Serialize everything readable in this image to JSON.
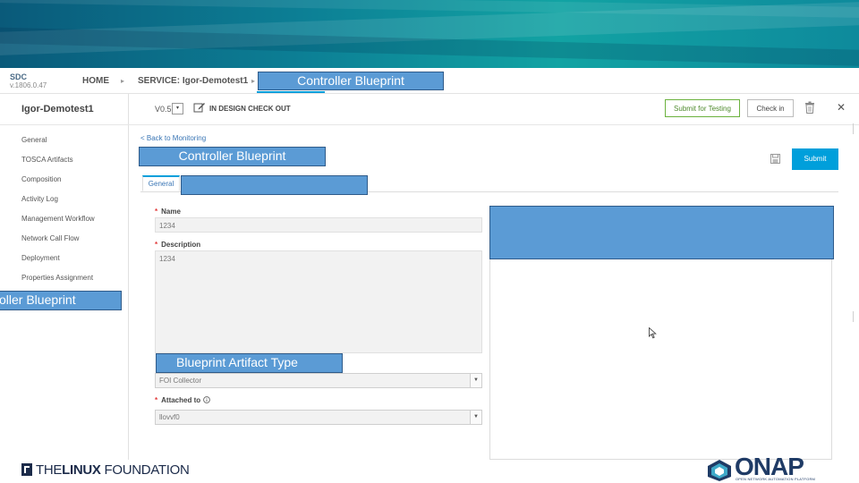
{
  "app": {
    "logo_title": "SDC",
    "logo_version": "v.1806.0.47"
  },
  "nav": {
    "home": "HOME",
    "service": "SERVICE: Igor-Demotest1"
  },
  "service_bar": {
    "title": "Igor-Demotest1",
    "version": "V0.5",
    "version_arrow": "▾",
    "status": "IN DESIGN CHECK OUT",
    "submit_for_testing": "Submit for Testing",
    "check_in": "Check in",
    "close_glyph": "✕"
  },
  "sidebar": {
    "items": [
      {
        "label": "General"
      },
      {
        "label": "TOSCA Artifacts"
      },
      {
        "label": "Composition"
      },
      {
        "label": "Activity Log"
      },
      {
        "label": "Management Workflow"
      },
      {
        "label": "Network Call Flow"
      },
      {
        "label": "Deployment"
      },
      {
        "label": "Properties Assignment"
      }
    ]
  },
  "main": {
    "back_link": "< Back to Monitoring",
    "submit": "Submit",
    "tab_general": "General",
    "fields": {
      "name_label": "Name",
      "name_value": "1234",
      "description_label": "Description",
      "description_value": "1234",
      "artifact_type_value": "FOI Collector",
      "attached_to_label": "Attached to",
      "attached_to_value": "llovvf0",
      "required_mark": "*"
    }
  },
  "callouts": {
    "nav_label": "Controller Blueprint",
    "header_label": "Controller Blueprint",
    "side_label": "oller Blueprint",
    "artifact_type_label": "Blueprint Artifact Type",
    "tab_label": "",
    "panel_label": ""
  },
  "footer": {
    "lf_prefix": "THE",
    "lf_bold": "LINUX",
    "lf_suffix": " FOUNDATION",
    "onap": "ONAP",
    "onap_tagline": "OPEN NETWORK AUTOMATION PLATFORM"
  },
  "colors": {
    "accent": "#009fdb",
    "callout": "#5b9bd5",
    "check_green": "#6bb23e",
    "banner_teal": "#0c7f95",
    "onap_navy": "#1f3b66"
  }
}
